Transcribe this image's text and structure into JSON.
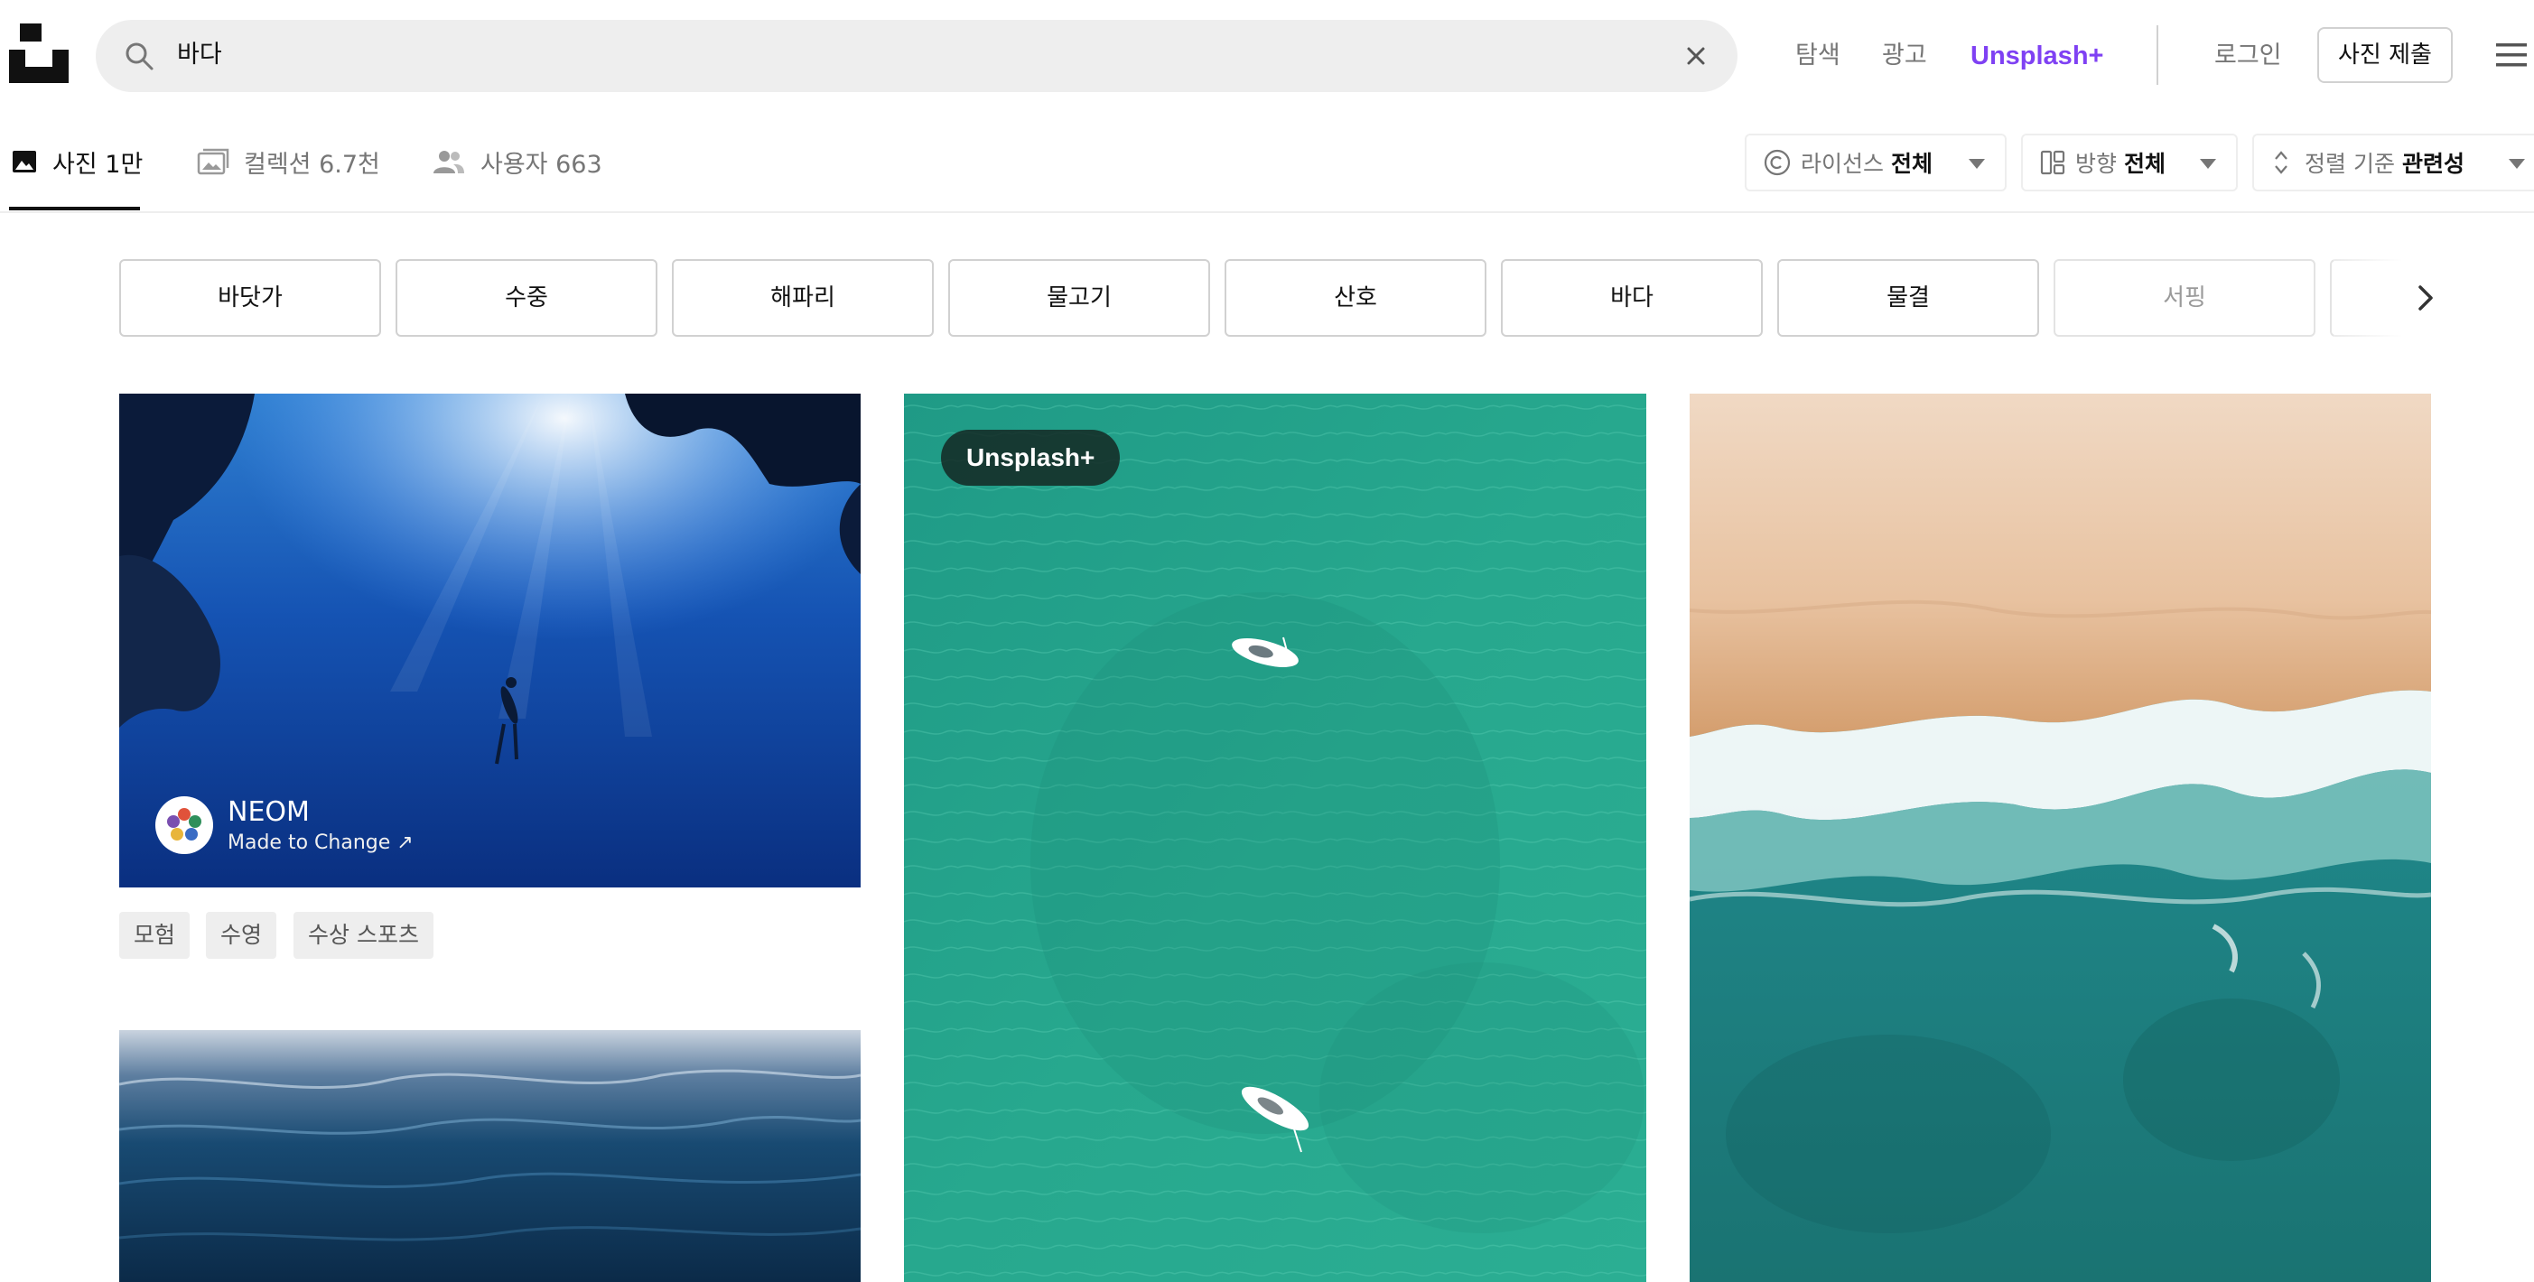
{
  "header": {
    "logo_icon": "unsplash-logo-icon",
    "search": {
      "value": "바다",
      "icon": "search-icon",
      "clear_icon": "close-icon"
    },
    "nav": [
      {
        "label": "탐색"
      },
      {
        "label": "광고"
      },
      {
        "label": "Unsplash+",
        "color": "#7f41f3"
      }
    ],
    "login": "로그인",
    "submit_photo": "사진 제출",
    "menu_icon": "hamburger-menu-icon"
  },
  "tabs": [
    {
      "label": "사진 1만",
      "icon": "image-icon",
      "active": true
    },
    {
      "label": "컬렉션 6.7천",
      "icon": "collection-icon",
      "active": false
    },
    {
      "label": "사용자 663",
      "icon": "users-icon",
      "active": false
    }
  ],
  "filters": [
    {
      "prefix": "라이선스",
      "value": "전체",
      "icon": "copyright-icon"
    },
    {
      "prefix": "방향",
      "value": "전체",
      "icon": "orientation-icon"
    },
    {
      "prefix": "정렬 기준",
      "value": "관련성",
      "icon": "sort-icon"
    }
  ],
  "related_searches": [
    "바닷가",
    "수중",
    "해파리",
    "물고기",
    "산호",
    "바다",
    "물결",
    "서핑"
  ],
  "photos": {
    "col1_top": {
      "author_name": "NEOM",
      "author_subtitle": "Made to Change ↗",
      "tags": [
        "모험",
        "수영",
        "수상 스포츠"
      ]
    },
    "col2_top": {
      "badge": "Unsplash+"
    }
  },
  "colors": {
    "accent_purple": "#7f41f3",
    "text_primary": "#111111",
    "text_secondary": "#767676",
    "chip_border": "#d1d1d1",
    "search_bg": "#eeeeee"
  }
}
